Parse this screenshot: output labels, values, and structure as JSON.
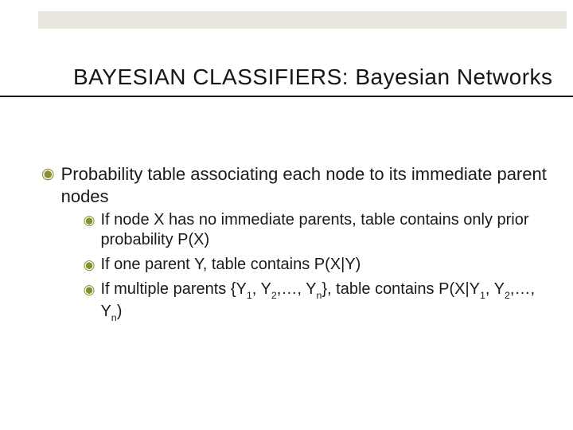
{
  "colors": {
    "accent": "#8a8f33",
    "band": "#e9e6dd",
    "underline": "#111111"
  },
  "title": "BAYESIAN CLASSIFIERS: Bayesian Networks",
  "bullets": [
    {
      "text": "Probability table associating each node to its immediate parent nodes",
      "marker": "◉",
      "sub": [
        {
          "text": "If node X has no immediate parents, table contains only prior probability P(X)",
          "marker": "◉"
        },
        {
          "text": "If one parent Y, table contains P(X|Y)",
          "marker": "◉"
        },
        {
          "marker": "◉",
          "segments": [
            {
              "t": "If multiple parents {Y"
            },
            {
              "t": "1",
              "sub": true
            },
            {
              "t": ", Y"
            },
            {
              "t": "2",
              "sub": true
            },
            {
              "t": ",…, Y"
            },
            {
              "t": "n",
              "sub": true
            },
            {
              "t": "}, table contains P(X|Y"
            },
            {
              "t": "1",
              "sub": true
            },
            {
              "t": ", Y"
            },
            {
              "t": "2",
              "sub": true
            },
            {
              "t": ",…, Y"
            },
            {
              "t": "n",
              "sub": true
            },
            {
              "t": ")"
            }
          ]
        }
      ]
    }
  ]
}
